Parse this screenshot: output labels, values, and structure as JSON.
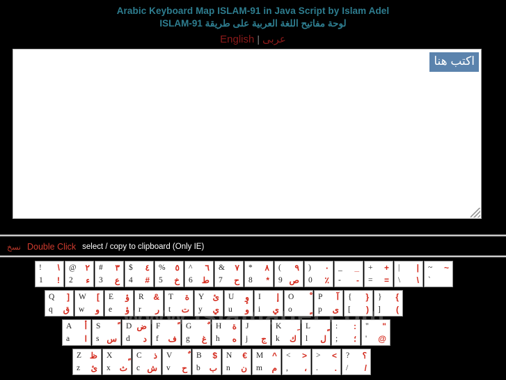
{
  "header": {
    "title_en": "Arabic Keyboard Map ISLAM-91 in Java Script by Islam Adel",
    "title_ar": "لوحة مفاتيح اللغة العربية على طريقة ISLAM-91",
    "lang_english": "English",
    "lang_separator": "|",
    "lang_arabic": "عربى"
  },
  "editor": {
    "selected_text": "اكتب هنا",
    "value": "اكتب هنا",
    "placeholder": ""
  },
  "copy_hint": {
    "arabic": "نسخ",
    "action": "Double Click",
    "description": "select / copy to clipboard (Only IE)"
  },
  "watermark": "www.islamadel.com",
  "colors": {
    "background": "#000000",
    "title": "#2e7d8f",
    "link": "#8b1a1a",
    "arabic_key": "#d42b1e",
    "selection": "#5b83ad",
    "rule": "#c9c9c9"
  },
  "keyboard": {
    "rows": [
      {
        "id": "row-digits",
        "keys": [
          {
            "shift_lat": "!",
            "shift_ar": "\\",
            "lat": "1",
            "ar": "!"
          },
          {
            "shift_lat": "@",
            "shift_ar": "٢",
            "lat": "2",
            "ar": "ء"
          },
          {
            "shift_lat": "#",
            "shift_ar": "٣",
            "lat": "3",
            "ar": "ع"
          },
          {
            "shift_lat": "$",
            "shift_ar": "٤",
            "lat": "4",
            "ar": "#"
          },
          {
            "shift_lat": "%",
            "shift_ar": "٥",
            "lat": "5",
            "ar": "خ"
          },
          {
            "shift_lat": "^",
            "shift_ar": "٦",
            "lat": "6",
            "ar": "ط"
          },
          {
            "shift_lat": "&",
            "shift_ar": "٧",
            "lat": "7",
            "ar": "ح"
          },
          {
            "shift_lat": "*",
            "shift_ar": "٨",
            "lat": "8",
            "ar": "*"
          },
          {
            "shift_lat": "(",
            "shift_ar": "٩",
            "lat": "9",
            "ar": "ص"
          },
          {
            "shift_lat": ")",
            "shift_ar": "٠",
            "lat": "0",
            "ar": "٪"
          },
          {
            "shift_lat": "_",
            "shift_ar": "_",
            "lat": "-",
            "ar": "-"
          },
          {
            "shift_lat": "+",
            "shift_ar": "+",
            "lat": "=",
            "ar": "="
          },
          {
            "shift_lat": "|",
            "shift_ar": "|",
            "lat": "\\",
            "ar": "\\"
          },
          {
            "shift_lat": "~",
            "shift_ar": "~",
            "lat": "`",
            "ar": ""
          }
        ]
      },
      {
        "id": "row-qwerty",
        "keys": [
          {
            "shift_lat": "Q",
            "shift_ar": "[",
            "lat": "q",
            "ar": "ق"
          },
          {
            "shift_lat": "W",
            "shift_ar": "]",
            "lat": "w",
            "ar": "و"
          },
          {
            "shift_lat": "E",
            "shift_ar": "ؤ",
            "lat": "e",
            "ar": "ؤ"
          },
          {
            "shift_lat": "R",
            "shift_ar": "&",
            "lat": "r",
            "ar": "ر"
          },
          {
            "shift_lat": "T",
            "shift_ar": "ة",
            "lat": "t",
            "ar": "ت"
          },
          {
            "shift_lat": "Y",
            "shift_ar": "ئ",
            "lat": "y",
            "ar": "ي"
          },
          {
            "shift_lat": "U",
            "shift_ar": "وٕ",
            "lat": "u",
            "ar": "و"
          },
          {
            "shift_lat": "I",
            "shift_ar": "إ",
            "lat": "i",
            "ar": "ي"
          },
          {
            "shift_lat": "O",
            "shift_ar": "ْ",
            "lat": "o",
            "ar": "ٍ"
          },
          {
            "shift_lat": "P",
            "shift_ar": "آ",
            "lat": "p",
            "ar": "ى"
          },
          {
            "shift_lat": "{",
            "shift_ar": "{",
            "lat": "[",
            "ar": "("
          },
          {
            "shift_lat": "}",
            "shift_ar": "}",
            "lat": "]",
            "ar": ")"
          }
        ]
      },
      {
        "id": "row-asdf",
        "keys": [
          {
            "shift_lat": "A",
            "shift_ar": "أ",
            "lat": "a",
            "ar": "ا"
          },
          {
            "shift_lat": "S",
            "shift_ar": "ً",
            "lat": "s",
            "ar": "س"
          },
          {
            "shift_lat": "D",
            "shift_ar": "ض",
            "lat": "d",
            "ar": "د"
          },
          {
            "shift_lat": "F",
            "shift_ar": "ً",
            "lat": "f",
            "ar": "ف"
          },
          {
            "shift_lat": "G",
            "shift_ar": "ٌ",
            "lat": "g",
            "ar": "غ"
          },
          {
            "shift_lat": "H",
            "shift_ar": "ة",
            "lat": "h",
            "ar": "ه"
          },
          {
            "shift_lat": "J",
            "shift_ar": "",
            "lat": "j",
            "ar": "ج"
          },
          {
            "shift_lat": "K",
            "shift_ar": "ِ",
            "lat": "k",
            "ar": "ك"
          },
          {
            "shift_lat": "L",
            "shift_ar": "ٍ",
            "lat": "l",
            "ar": "ل"
          },
          {
            "shift_lat": ":",
            "shift_ar": ":",
            "lat": ";",
            "ar": "؛"
          },
          {
            "shift_lat": "\"",
            "shift_ar": "\"",
            "lat": "'",
            "ar": "@"
          }
        ]
      },
      {
        "id": "row-zxcv",
        "keys": [
          {
            "shift_lat": "Z",
            "shift_ar": "ظ",
            "lat": "z",
            "ar": "ئ"
          },
          {
            "shift_lat": "X",
            "shift_ar": "ٍ",
            "lat": "x",
            "ar": "ث"
          },
          {
            "shift_lat": "C",
            "shift_ar": "ذ",
            "lat": "c",
            "ar": "ش"
          },
          {
            "shift_lat": "V",
            "shift_ar": "ٌ",
            "lat": "v",
            "ar": "ح"
          },
          {
            "shift_lat": "B",
            "shift_ar": "$",
            "lat": "b",
            "ar": "ب"
          },
          {
            "shift_lat": "N",
            "shift_ar": "€",
            "lat": "n",
            "ar": "ن"
          },
          {
            "shift_lat": "M",
            "shift_ar": "^",
            "lat": "m",
            "ar": "م"
          },
          {
            "shift_lat": "<",
            "shift_ar": "<",
            "lat": ",",
            "ar": "،"
          },
          {
            "shift_lat": ">",
            "shift_ar": ">",
            "lat": ".",
            "ar": "."
          },
          {
            "shift_lat": "?",
            "shift_ar": "؟",
            "lat": "/",
            "ar": "/"
          }
        ]
      }
    ]
  }
}
